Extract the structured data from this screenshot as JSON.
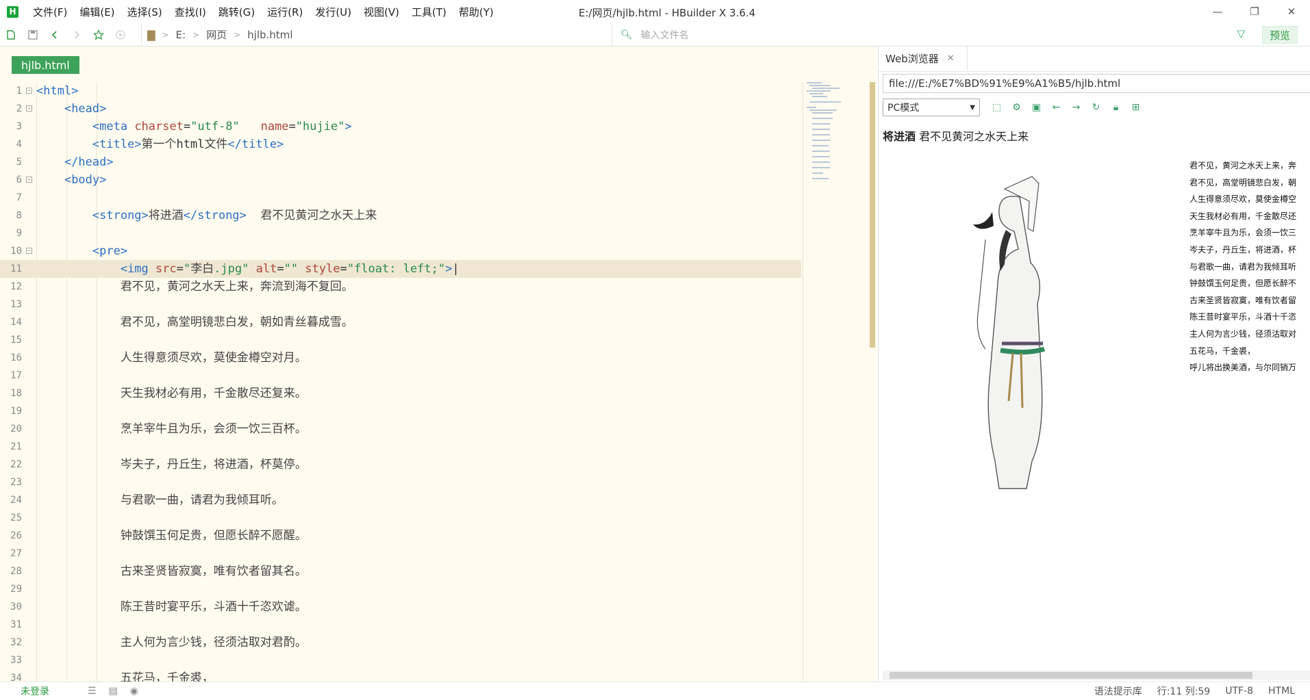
{
  "app": {
    "logo": "H",
    "title": "E:/网页/hjlb.html - HBuilder X 3.6.4"
  },
  "menu": [
    "文件(F)",
    "编辑(E)",
    "选择(S)",
    "查找(I)",
    "跳转(G)",
    "运行(R)",
    "发行(U)",
    "视图(V)",
    "工具(T)",
    "帮助(Y)"
  ],
  "window_controls": {
    "minimize": "—",
    "restore": "❐",
    "close": "✕"
  },
  "breadcrumb": {
    "drive": "E:",
    "folder": "网页",
    "file": "hjlb.html"
  },
  "file_search": {
    "placeholder": "输入文件名"
  },
  "preview_button": "预览",
  "editor": {
    "tab": "hjlb.html",
    "lines": [
      {
        "n": "1",
        "fold": true,
        "html": "<span class=\"tag\">&lt;html&gt;</span>"
      },
      {
        "n": "2",
        "fold": true,
        "html": "    <span class=\"tag\">&lt;head&gt;</span>"
      },
      {
        "n": "3",
        "fold": false,
        "html": "        <span class=\"tag\">&lt;meta</span> <span class=\"attr\">charset</span>=<span class=\"str\">\"utf-8\"</span>   <span class=\"attr\">name</span>=<span class=\"str\">\"hujie\"</span><span class=\"tag\">&gt;</span>"
      },
      {
        "n": "4",
        "fold": false,
        "html": "        <span class=\"tag\">&lt;title&gt;</span><span class=\"cn\">第一个</span>html<span class=\"cn\">文件</span><span class=\"tag\">&lt;/title&gt;</span>"
      },
      {
        "n": "5",
        "fold": false,
        "html": "    <span class=\"tag\">&lt;/head&gt;</span>"
      },
      {
        "n": "6",
        "fold": true,
        "html": "    <span class=\"tag\">&lt;body&gt;</span>"
      },
      {
        "n": "7",
        "fold": false,
        "html": ""
      },
      {
        "n": "8",
        "fold": false,
        "html": "        <span class=\"tag\">&lt;strong&gt;</span><span class=\"cn\">将进酒</span><span class=\"tag\">&lt;/strong&gt;</span>  <span class=\"cn\">君不见黄河之水天上来</span>"
      },
      {
        "n": "9",
        "fold": false,
        "html": ""
      },
      {
        "n": "10",
        "fold": true,
        "html": "        <span class=\"tag\">&lt;pre&gt;</span>"
      },
      {
        "n": "11",
        "fold": false,
        "cur": true,
        "html": "            <span class=\"tag\">&lt;img</span> <span class=\"attr\">src</span>=<span class=\"str\">\"<span class=\"cn\">李白</span>.jpg\"</span> <span class=\"attr\">alt</span>=<span class=\"str\">\"\"</span> <span class=\"attr\">style</span>=<span class=\"str\">\"float: left;\"</span><span class=\"tag\">&gt;</span>|"
      },
      {
        "n": "12",
        "fold": false,
        "html": "            <span class=\"cn\">君不见，黄河之水天上来，奔流到海不复回。</span>"
      },
      {
        "n": "13",
        "fold": false,
        "html": ""
      },
      {
        "n": "14",
        "fold": false,
        "html": "            <span class=\"cn\">君不见，高堂明镜悲白发，朝如青丝暮成雪。</span>"
      },
      {
        "n": "15",
        "fold": false,
        "html": ""
      },
      {
        "n": "16",
        "fold": false,
        "html": "            <span class=\"cn\">人生得意须尽欢，莫使金樽空对月。</span>"
      },
      {
        "n": "17",
        "fold": false,
        "html": ""
      },
      {
        "n": "18",
        "fold": false,
        "html": "            <span class=\"cn\">天生我材必有用，千金散尽还复来。</span>"
      },
      {
        "n": "19",
        "fold": false,
        "html": ""
      },
      {
        "n": "20",
        "fold": false,
        "html": "            <span class=\"cn\">烹羊宰牛且为乐，会须一饮三百杯。</span>"
      },
      {
        "n": "21",
        "fold": false,
        "html": ""
      },
      {
        "n": "22",
        "fold": false,
        "html": "            <span class=\"cn\">岑夫子，丹丘生，将进酒，杯莫停。</span>"
      },
      {
        "n": "23",
        "fold": false,
        "html": ""
      },
      {
        "n": "24",
        "fold": false,
        "html": "            <span class=\"cn\">与君歌一曲，请君为我倾耳听。</span>"
      },
      {
        "n": "25",
        "fold": false,
        "html": ""
      },
      {
        "n": "26",
        "fold": false,
        "html": "            <span class=\"cn\">钟鼓馔玉何足贵，但愿长醉不愿醒。</span>"
      },
      {
        "n": "27",
        "fold": false,
        "html": ""
      },
      {
        "n": "28",
        "fold": false,
        "html": "            <span class=\"cn\">古来圣贤皆寂寞，唯有饮者留其名。</span>"
      },
      {
        "n": "29",
        "fold": false,
        "html": ""
      },
      {
        "n": "30",
        "fold": false,
        "html": "            <span class=\"cn\">陈王昔时宴平乐，斗酒十千恣欢谑。</span>"
      },
      {
        "n": "31",
        "fold": false,
        "html": ""
      },
      {
        "n": "32",
        "fold": false,
        "html": "            <span class=\"cn\">主人何为言少钱，径须沽取对君酌。</span>"
      },
      {
        "n": "33",
        "fold": false,
        "html": ""
      },
      {
        "n": "34",
        "fold": false,
        "html": "            <span class=\"cn\">五花马，千金裘，</span>"
      }
    ]
  },
  "browser": {
    "tab": "Web浏览器",
    "url": "file:///E:/%E7%BD%91%E9%A1%B5/hjlb.html",
    "mode": "PC模式",
    "heading_bold": "将进酒",
    "heading_text": "君不见黄河之水天上来",
    "poem_lines": [
      "君不见，黄河之水天上来，奔",
      "君不见，高堂明镜悲白发，朝",
      "人生得意须尽欢，莫使金樽空",
      "天生我材必有用，千金散尽还",
      "烹羊宰牛且为乐，会须一饮三",
      "岑夫子，丹丘生，将进酒，杯",
      "与君歌一曲，请君为我倾耳听",
      "钟鼓馔玉何足贵，但愿长醉不",
      "古来圣贤皆寂寞，唯有饮者留",
      "陈王昔时宴平乐，斗酒十千恣",
      "主人何为言少钱，径须沽取对",
      "五花马，千金裘，",
      "呼儿将出换美酒，与尔同销万"
    ]
  },
  "status": {
    "login": "未登录",
    "lib": "语法提示库",
    "pos": "行:11  列:59",
    "enc": "UTF-8",
    "lang": "HTML"
  }
}
